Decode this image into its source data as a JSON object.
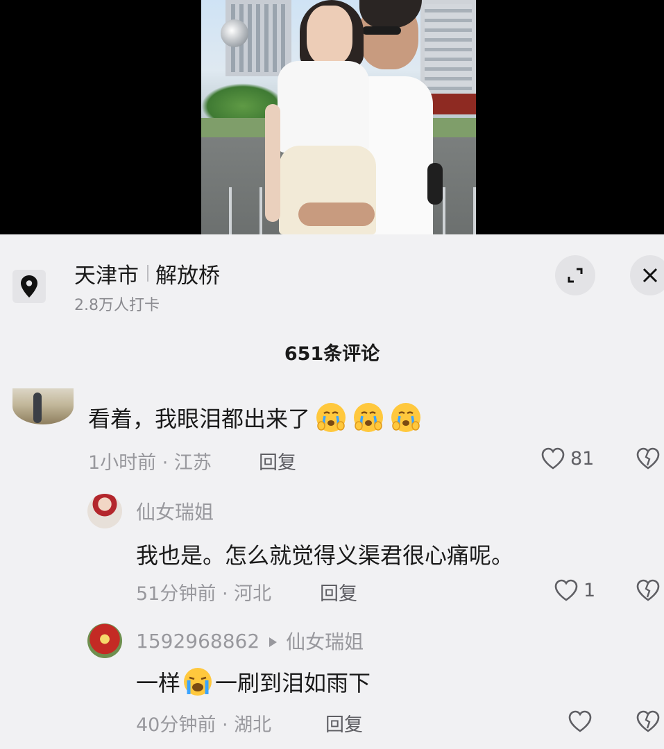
{
  "location": {
    "city": "天津市",
    "place": "解放桥",
    "checkins": "2.8万人打卡"
  },
  "comments_header": "651条评论",
  "comments": [
    {
      "text": "看着，我眼泪都出来了",
      "emoji": "crying-face",
      "emoji_count": 3,
      "meta": "1小时前 · 江苏",
      "reply_label": "回复",
      "likes": "81"
    },
    {
      "user": "仙女瑞姐",
      "text": "我也是。怎么就觉得义渠君很心痛呢。",
      "meta": "51分钟前 · 河北",
      "reply_label": "回复",
      "likes": "1"
    },
    {
      "user": "1592968862",
      "reply_to": "仙女瑞姐",
      "text_before": "一样",
      "emoji": "loudly-crying-face",
      "text_after": "一刷到泪如雨下",
      "meta": "40分钟前 · 湖北",
      "reply_label": "回复",
      "likes": ""
    }
  ],
  "colors": {
    "panel_bg": "#f1f1f3",
    "meta_text": "#98989d",
    "primary_text": "#1a1a1a"
  }
}
